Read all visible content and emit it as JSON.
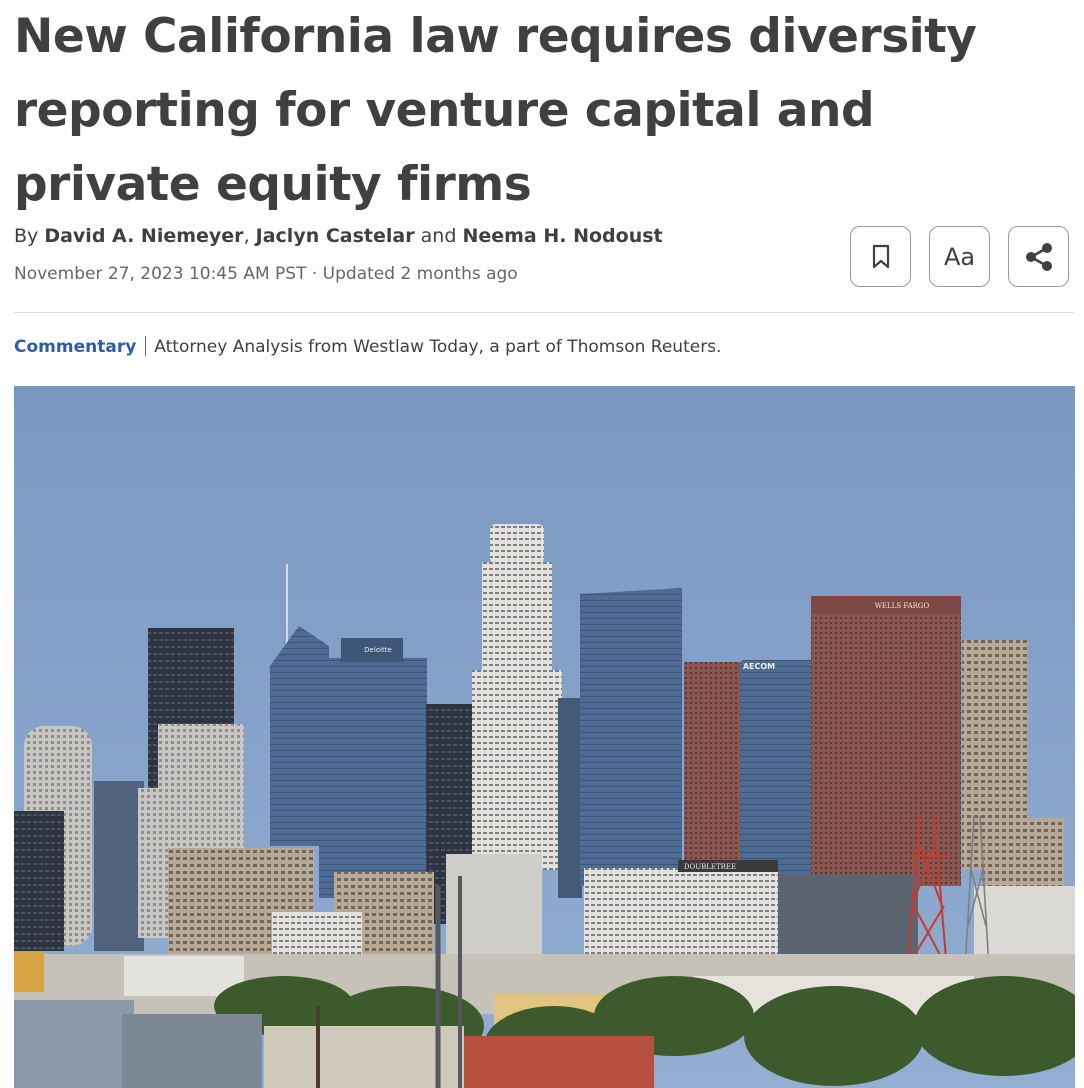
{
  "article": {
    "headline": "New California law requires diversity reporting for venture capital and private equity firms",
    "byline": {
      "prefix": "By ",
      "author1": "David A. Niemeyer",
      "sep1": ", ",
      "author2": "Jaclyn Castelar",
      "sep2": " and ",
      "author3": "Neema H. Nodoust"
    },
    "dateline": "November 27, 2023 10:45 AM PST · Updated 2 months ago",
    "kicker": {
      "tag": "Commentary",
      "description": "Attorney Analysis from Westlaw Today, a part of Thomson Reuters."
    }
  },
  "actions": {
    "bookmark_icon": "bookmark-icon",
    "text_size_label": "Aa",
    "share_icon": "share-icon"
  },
  "image": {
    "sign_wells_fargo": "WELLS FARGO",
    "sign_aecom": "AECOM",
    "sign_doubletree": "DOUBLETREE",
    "sign_deloitte": "Deloitte"
  },
  "colors": {
    "headline": "#404040",
    "link_blue": "#2b5da8",
    "sky": "#7f9cc4"
  }
}
